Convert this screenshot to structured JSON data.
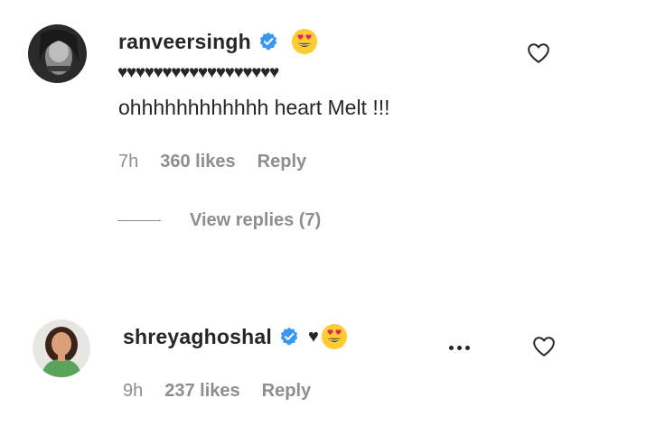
{
  "comments": [
    {
      "username": "ranveersingh",
      "verified": true,
      "hearts": "♥♥♥♥♥♥♥♥♥♥♥♥♥♥♥♥♥♥",
      "text": "ohhhhhhhhhhhh heart Melt !!!",
      "time": "7h",
      "likes": "360 likes",
      "reply_label": "Reply",
      "view_replies": "View replies (7)",
      "emoji": "heart-eyes-emoji"
    },
    {
      "username": "shreyaghoshal",
      "verified": true,
      "heart": "♥",
      "emoji": "heart-eyes-emoji",
      "time": "9h",
      "likes": "237 likes",
      "reply_label": "Reply"
    }
  ],
  "colors": {
    "text": "#262626",
    "secondary": "#8e8e8e",
    "verified": "#3897f0",
    "emoji_face": "#ffcc33",
    "emoji_heart": "#e0245e"
  }
}
